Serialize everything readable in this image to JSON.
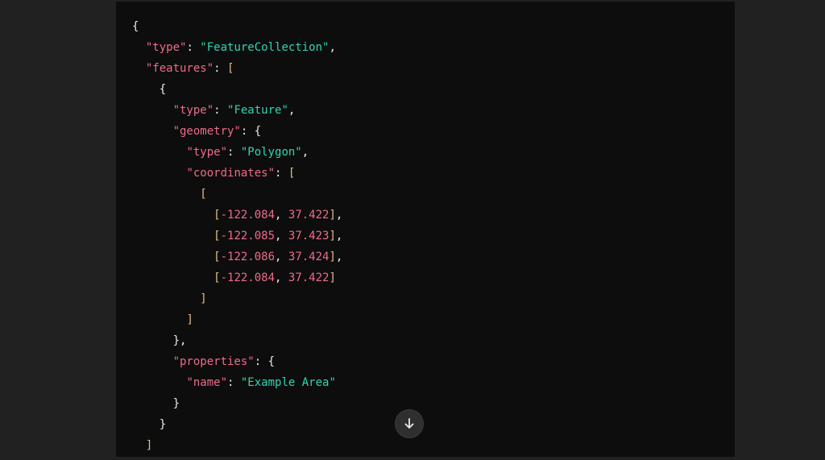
{
  "code_block": {
    "language": "json",
    "lines": [
      [
        {
          "t": "{",
          "c": "punc"
        }
      ],
      [
        {
          "t": "  ",
          "c": "punc"
        },
        {
          "t": "\"type\"",
          "c": "key"
        },
        {
          "t": ": ",
          "c": "punc"
        },
        {
          "t": "\"FeatureCollection\"",
          "c": "str"
        },
        {
          "t": ",",
          "c": "punc"
        }
      ],
      [
        {
          "t": "  ",
          "c": "punc"
        },
        {
          "t": "\"features\"",
          "c": "key"
        },
        {
          "t": ": ",
          "c": "punc"
        },
        {
          "t": "[",
          "c": "brk"
        }
      ],
      [
        {
          "t": "    {",
          "c": "punc"
        }
      ],
      [
        {
          "t": "      ",
          "c": "punc"
        },
        {
          "t": "\"type\"",
          "c": "key"
        },
        {
          "t": ": ",
          "c": "punc"
        },
        {
          "t": "\"Feature\"",
          "c": "str"
        },
        {
          "t": ",",
          "c": "punc"
        }
      ],
      [
        {
          "t": "      ",
          "c": "punc"
        },
        {
          "t": "\"geometry\"",
          "c": "key"
        },
        {
          "t": ": {",
          "c": "punc"
        }
      ],
      [
        {
          "t": "        ",
          "c": "punc"
        },
        {
          "t": "\"type\"",
          "c": "key"
        },
        {
          "t": ": ",
          "c": "punc"
        },
        {
          "t": "\"Polygon\"",
          "c": "str"
        },
        {
          "t": ",",
          "c": "punc"
        }
      ],
      [
        {
          "t": "        ",
          "c": "punc"
        },
        {
          "t": "\"coordinates\"",
          "c": "key"
        },
        {
          "t": ": ",
          "c": "punc"
        },
        {
          "t": "[",
          "c": "brk"
        }
      ],
      [
        {
          "t": "          ",
          "c": "punc"
        },
        {
          "t": "[",
          "c": "brk"
        }
      ],
      [
        {
          "t": "            ",
          "c": "punc"
        },
        {
          "t": "[",
          "c": "brk"
        },
        {
          "t": "-122.084",
          "c": "num"
        },
        {
          "t": ", ",
          "c": "punc"
        },
        {
          "t": "37.422",
          "c": "num"
        },
        {
          "t": "]",
          "c": "brk"
        },
        {
          "t": ",",
          "c": "punc"
        }
      ],
      [
        {
          "t": "            ",
          "c": "punc"
        },
        {
          "t": "[",
          "c": "brk"
        },
        {
          "t": "-122.085",
          "c": "num"
        },
        {
          "t": ", ",
          "c": "punc"
        },
        {
          "t": "37.423",
          "c": "num"
        },
        {
          "t": "]",
          "c": "brk"
        },
        {
          "t": ",",
          "c": "punc"
        }
      ],
      [
        {
          "t": "            ",
          "c": "punc"
        },
        {
          "t": "[",
          "c": "brk"
        },
        {
          "t": "-122.086",
          "c": "num"
        },
        {
          "t": ", ",
          "c": "punc"
        },
        {
          "t": "37.424",
          "c": "num"
        },
        {
          "t": "]",
          "c": "brk"
        },
        {
          "t": ",",
          "c": "punc"
        }
      ],
      [
        {
          "t": "            ",
          "c": "punc"
        },
        {
          "t": "[",
          "c": "brk"
        },
        {
          "t": "-122.084",
          "c": "num"
        },
        {
          "t": ", ",
          "c": "punc"
        },
        {
          "t": "37.422",
          "c": "num"
        },
        {
          "t": "]",
          "c": "brk"
        }
      ],
      [
        {
          "t": "          ",
          "c": "punc"
        },
        {
          "t": "]",
          "c": "brk"
        }
      ],
      [
        {
          "t": "        ",
          "c": "punc"
        },
        {
          "t": "]",
          "c": "brk"
        }
      ],
      [
        {
          "t": "      },",
          "c": "punc"
        }
      ],
      [
        {
          "t": "      ",
          "c": "punc"
        },
        {
          "t": "\"properties\"",
          "c": "key"
        },
        {
          "t": ": {",
          "c": "punc"
        }
      ],
      [
        {
          "t": "        ",
          "c": "punc"
        },
        {
          "t": "\"name\"",
          "c": "key"
        },
        {
          "t": ": ",
          "c": "punc"
        },
        {
          "t": "\"Example Area\"",
          "c": "str"
        }
      ],
      [
        {
          "t": "      }",
          "c": "punc"
        }
      ],
      [
        {
          "t": "    }",
          "c": "punc"
        }
      ],
      [
        {
          "t": "  ",
          "c": "punc"
        },
        {
          "t": "]",
          "c": "brk"
        }
      ]
    ]
  },
  "scroll_button": {
    "icon": "arrow-down-icon"
  },
  "colors": {
    "page_background": "#212121",
    "code_background": "#0d0d0d",
    "json_key": "#ef6b8a",
    "json_string": "#2fd6b1",
    "json_number": "#ef6b8a",
    "punctuation": "#ececec",
    "bracket": "#e0c08a"
  }
}
